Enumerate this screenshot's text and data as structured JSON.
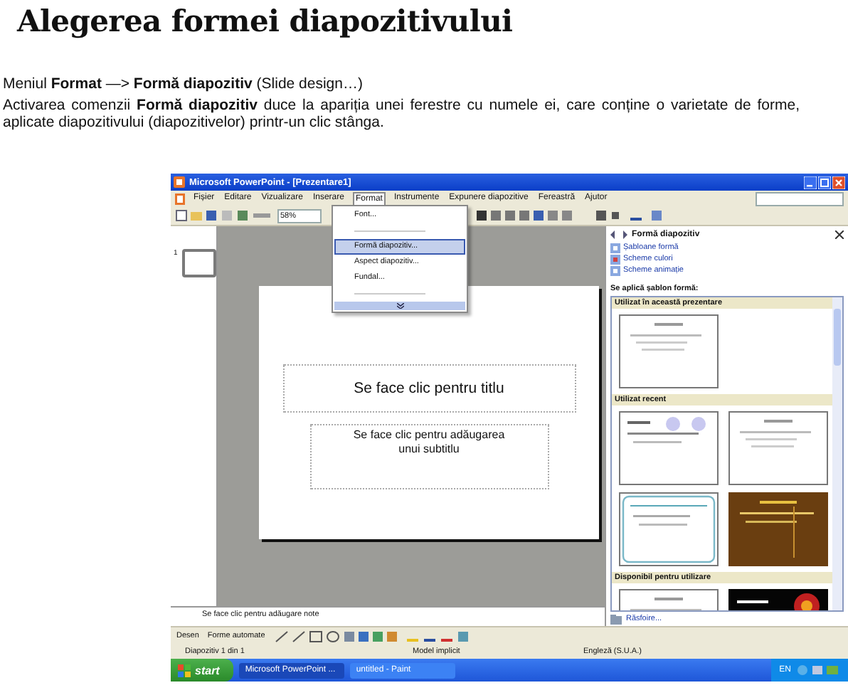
{
  "heading": "Alegerea formei diapozitivului",
  "menu_path": "Meniul **Format** —> **Formă diapozitiv** (Slide design…)",
  "paragraph": "Activarea comenzii **Formă diapozitiv** duce la apariția unei ferestre cu numele ei, care conține o varietate de forme, aplicate diapozitivului (diapozitivelor) printr-un clic stânga.",
  "screenshot": {
    "window_title": "Microsoft PowerPoint - [Prezentare1]",
    "menu_bar": [
      {
        "label": "Fișier",
        "selected": false
      },
      {
        "label": "Editare",
        "selected": false
      },
      {
        "label": "Vizualizare",
        "selected": false
      },
      {
        "label": "Inserare",
        "selected": false
      },
      {
        "label": "Format",
        "selected": true
      },
      {
        "label": "Instrumente",
        "selected": false
      },
      {
        "label": "Expunere diapozitive",
        "selected": false
      },
      {
        "label": "Fereastră",
        "selected": false
      },
      {
        "label": "Ajutor",
        "selected": false
      }
    ],
    "zoom": "58%",
    "format_menu": [
      {
        "kind": "item",
        "label": "Font...",
        "selected": false
      },
      {
        "kind": "disabled"
      },
      {
        "kind": "item",
        "label": "Formă diapozitiv...",
        "selected": true
      },
      {
        "kind": "item",
        "label": "Aspect diapozitiv...",
        "selected": false
      },
      {
        "kind": "item",
        "label": "Fundal...",
        "selected": false
      },
      {
        "kind": "disabled"
      },
      {
        "kind": "more"
      }
    ],
    "slide_number": "1",
    "slide": {
      "title_placeholder": "Se face clic pentru titlu",
      "subtitle_placeholder": "Se face clic pentru adăugarea unui subtitlu"
    },
    "notes_placeholder": "Se face clic pentru adăugare note",
    "task_pane": {
      "title": "Formă diapozitiv",
      "links": [
        "Șabloane formă",
        "Scheme culori",
        "Scheme animație"
      ],
      "apply_label": "Se aplică șablon formă:",
      "sections": [
        {
          "title": "Utilizat în această prezentare",
          "designs": [
            {
              "kind": "plain"
            }
          ]
        },
        {
          "title": "Utilizat recent",
          "designs": [
            {
              "kind": "bubbles"
            },
            {
              "kind": "plain"
            },
            {
              "kind": "teal"
            },
            {
              "kind": "brown"
            }
          ]
        },
        {
          "title": "Disponibil pentru utilizare",
          "designs": [
            {
              "kind": "plain"
            },
            {
              "kind": "dark"
            }
          ]
        }
      ],
      "browse": "Răsfoire..."
    },
    "drawing_toolbar": [
      "Desen",
      "Forme automate"
    ],
    "status_bar": [
      "Diapozitiv 1 din 1",
      "Model implicit",
      "Engleză (S.U.A.)"
    ],
    "taskbar": {
      "start": "start",
      "windows": [
        {
          "label": "Microsoft PowerPoint ...",
          "selected": true
        },
        {
          "label": "untitled - Paint",
          "selected": false
        }
      ],
      "language": "EN"
    }
  }
}
